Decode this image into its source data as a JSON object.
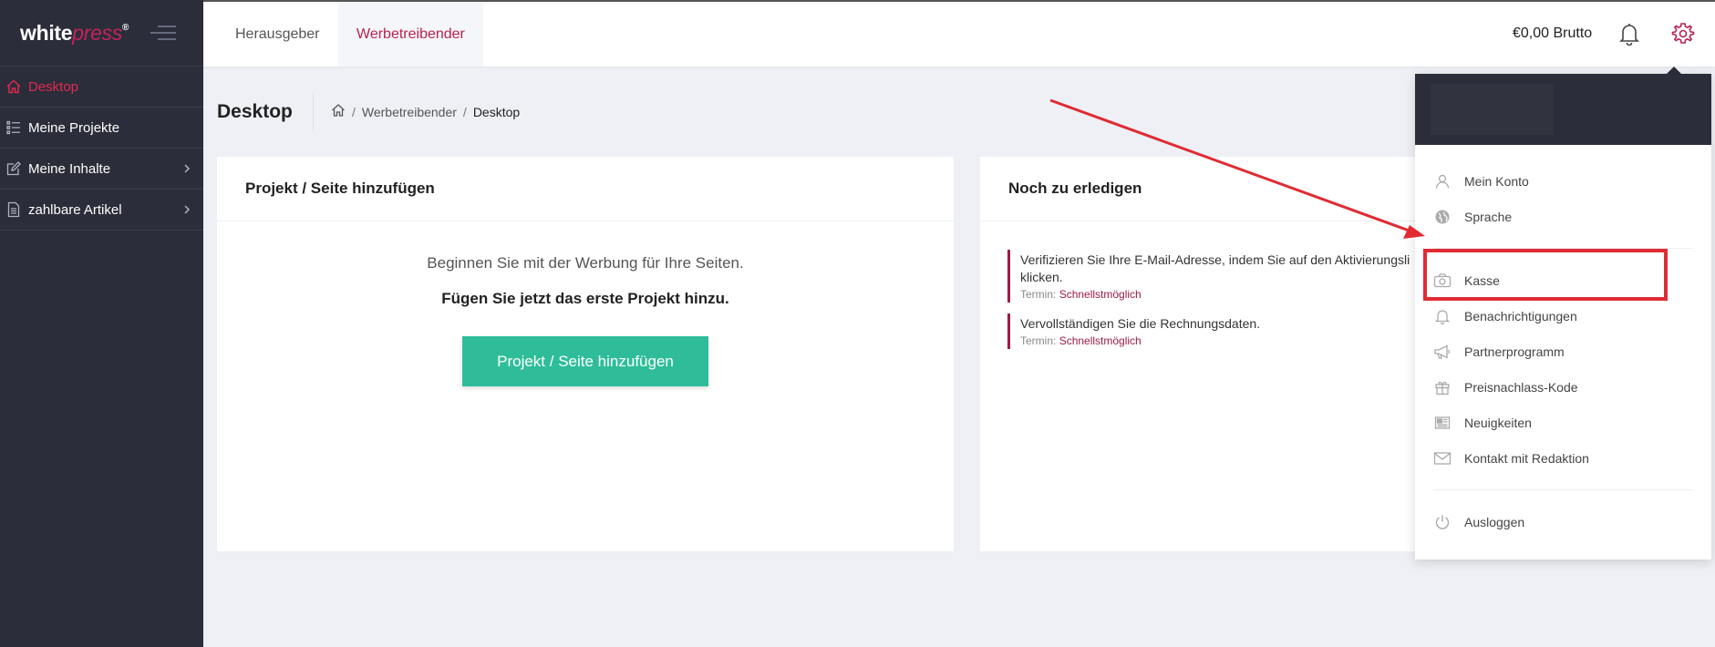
{
  "brand": {
    "name_main": "white",
    "name_accent": "press",
    "reg": "®"
  },
  "sidebar": {
    "items": [
      {
        "label": "Desktop",
        "icon": "home-icon",
        "active": true
      },
      {
        "label": "Meine Projekte",
        "icon": "list-icon"
      },
      {
        "label": "Meine Inhalte",
        "icon": "edit-icon",
        "has_submenu": true
      },
      {
        "label": "zahlbare Artikel",
        "icon": "document-icon",
        "has_submenu": true
      }
    ]
  },
  "header": {
    "tabs": [
      {
        "label": "Herausgeber",
        "active": false
      },
      {
        "label": "Werbetreibender",
        "active": true
      }
    ],
    "balance": "€0,00 Brutto"
  },
  "page": {
    "title": "Desktop",
    "breadcrumb": [
      "Werbetreibender",
      "Desktop"
    ]
  },
  "left_card": {
    "title": "Projekt / Seite hinzufügen",
    "intro": "Beginnen Sie mit der Werbung für Ihre Seiten.",
    "intro_strong": "Fügen Sie jetzt das erste Projekt hinzu.",
    "button_label": "Projekt / Seite hinzufügen"
  },
  "right_card": {
    "title": "Noch zu erledigen",
    "todos": [
      {
        "text_line1": "Verifizieren Sie Ihre E-Mail-Adresse, indem Sie auf den Aktivierungsli",
        "text_line2": "klicken.",
        "term_label": "Termin:",
        "term_value": "Schnellstmöglich"
      },
      {
        "text_line1": "Vervollständigen Sie die Rechnungsdaten.",
        "term_label": "Termin:",
        "term_value": "Schnellstmöglich"
      }
    ]
  },
  "dropdown": {
    "group1": [
      {
        "label": "Mein Konto",
        "icon": "user-icon"
      },
      {
        "label": "Sprache",
        "icon": "globe-icon"
      }
    ],
    "group2": [
      {
        "label": "Kasse",
        "icon": "camera-icon"
      },
      {
        "label": "Benachrichtigungen",
        "icon": "bell-icon"
      },
      {
        "label": "Partnerprogramm",
        "icon": "megaphone-icon"
      },
      {
        "label": "Preisnachlass-Kode",
        "icon": "gift-icon"
      },
      {
        "label": "Neuigkeiten",
        "icon": "news-icon"
      },
      {
        "label": "Kontakt mit Redaktion",
        "icon": "mail-icon"
      }
    ],
    "group3": [
      {
        "label": "Ausloggen",
        "icon": "power-icon"
      }
    ]
  },
  "colors": {
    "sidebar_bg": "#2b2d3a",
    "accent": "#b8224f",
    "active_nav": "#e02b4f",
    "cta": "#2fbd99",
    "annotation": "#e02b33"
  }
}
